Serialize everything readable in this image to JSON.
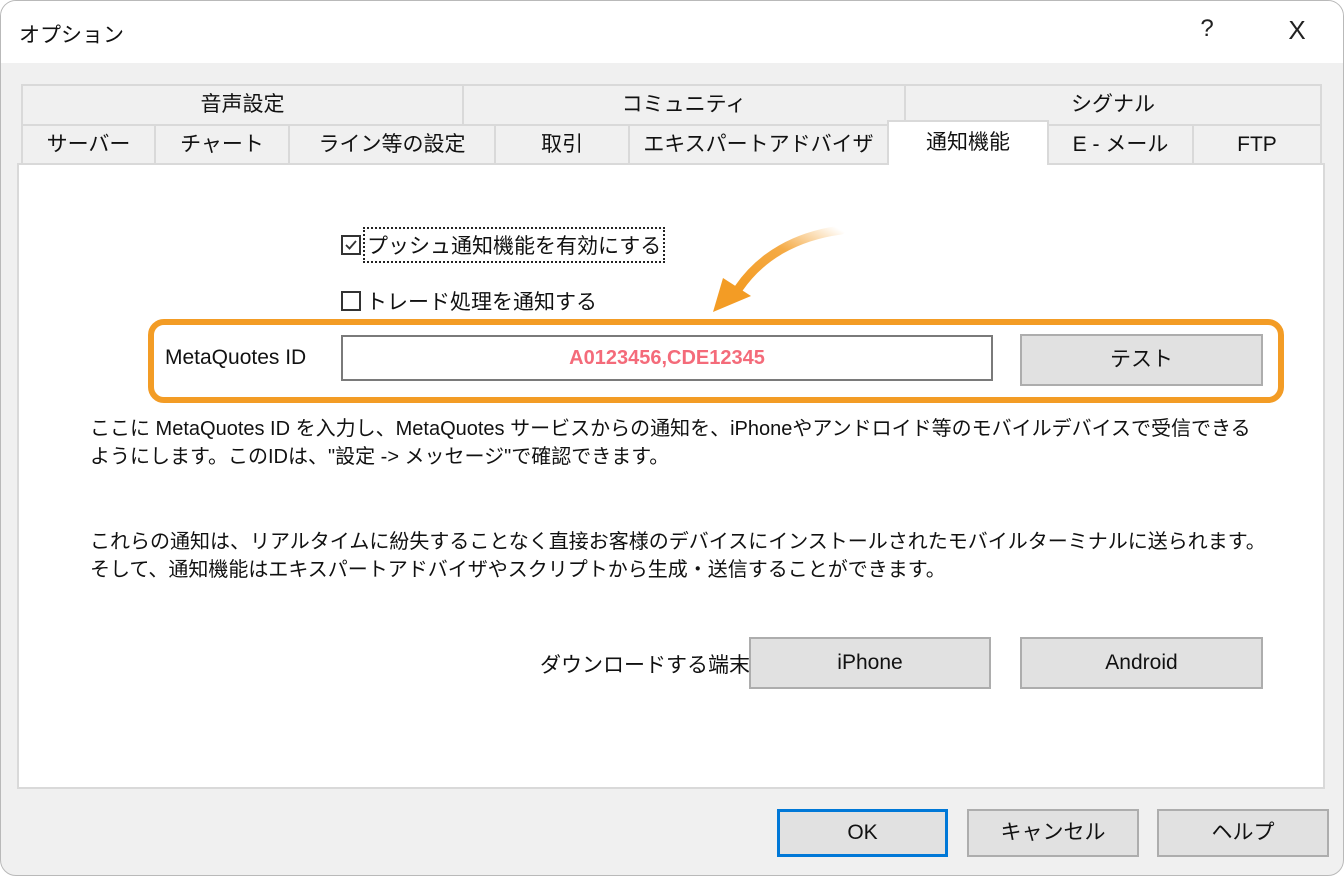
{
  "window": {
    "title": "オプション",
    "help_glyph": "?",
    "close_glyph": "X"
  },
  "tabs": {
    "row1": [
      {
        "label": "音声設定"
      },
      {
        "label": "コミュニティ"
      },
      {
        "label": "シグナル"
      }
    ],
    "row2": [
      {
        "label": "サーバー"
      },
      {
        "label": "チャート"
      },
      {
        "label": "ライン等の設定"
      },
      {
        "label": "取引"
      },
      {
        "label": "エキスパートアドバイザ"
      },
      {
        "label": "通知機能",
        "active": true
      },
      {
        "label": "E - メール"
      },
      {
        "label": "FTP"
      }
    ]
  },
  "notifications": {
    "enable_push": {
      "label": "プッシュ通知機能を有効にする",
      "checked": true
    },
    "notify_trades": {
      "label": "トレード処理を通知する",
      "checked": false
    },
    "metaquotes_id_label": "MetaQuotes ID",
    "metaquotes_id_value": "A0123456,CDE12345",
    "test_button": "テスト",
    "description_1": "ここに MetaQuotes ID を入力し、MetaQuotes サービスからの通知を、iPhoneやアンドロイド等のモバイルデバイスで受信できるようにします。このIDは、\"設定 -> メッセージ\"で確認できます。",
    "description_2": "これらの通知は、リアルタイムに紛失することなく直接お客様のデバイスにインストールされたモバイルターミナルに送られます。そして、通知機能はエキスパートアドバイザやスクリプトから生成・送信することができます。",
    "download_label": "ダウンロードする端末:",
    "iphone_button": "iPhone",
    "android_button": "Android"
  },
  "annotation": {
    "highlight_color": "#f39c25",
    "id_text_color": "#f46b7a"
  },
  "footer": {
    "ok": "OK",
    "cancel": "キャンセル",
    "help": "ヘルプ"
  }
}
